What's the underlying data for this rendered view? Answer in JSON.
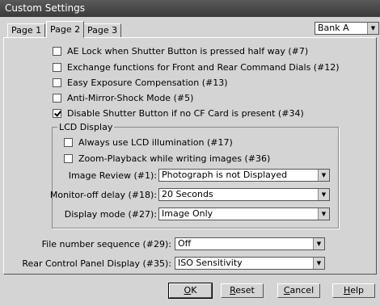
{
  "window": {
    "title": "Custom Settings"
  },
  "tabs": [
    {
      "label": "Page 1"
    },
    {
      "label": "Page 2"
    },
    {
      "label": "Page 3"
    }
  ],
  "bank": {
    "value": "Bank A"
  },
  "options": [
    {
      "label": "AE Lock when Shutter Button is pressed half way (#7)",
      "checked": false
    },
    {
      "label": "Exchange functions for Front and Rear Command Dials (#12)",
      "checked": false
    },
    {
      "label": "Easy Exposure Compensation (#13)",
      "checked": false
    },
    {
      "label": "Anti-Mirror-Shock Mode (#5)",
      "checked": false
    },
    {
      "label": "Disable Shutter Button if no CF Card is present (#34)",
      "checked": true
    }
  ],
  "lcd": {
    "title": "LCD Display",
    "options": [
      {
        "label": "Always use LCD illumination (#17)",
        "checked": false
      },
      {
        "label": "Zoom-Playback while writing images (#36)",
        "checked": false
      }
    ],
    "fields": [
      {
        "label": "Image Review (#1):",
        "value": "Photograph is not Displayed"
      },
      {
        "label": "Monitor-off delay (#18):",
        "value": "20 Seconds"
      },
      {
        "label": "Display mode (#27):",
        "value": "Image Only"
      }
    ]
  },
  "fields": [
    {
      "label": "File number sequence (#29):",
      "value": "Off"
    },
    {
      "label": "Rear Control Panel Display (#35):",
      "value": "ISO Sensitivity"
    }
  ],
  "buttons": {
    "ok_mnemonic": "O",
    "ok_rest": "K",
    "reset_mnemonic": "R",
    "reset_rest": "eset",
    "cancel_mnemonic": "C",
    "cancel_rest": "ancel",
    "help_mnemonic": "H",
    "help_rest": "elp"
  },
  "colors": {
    "titlebar": "#3a3a3a",
    "dialog": "#d4d4d4"
  }
}
